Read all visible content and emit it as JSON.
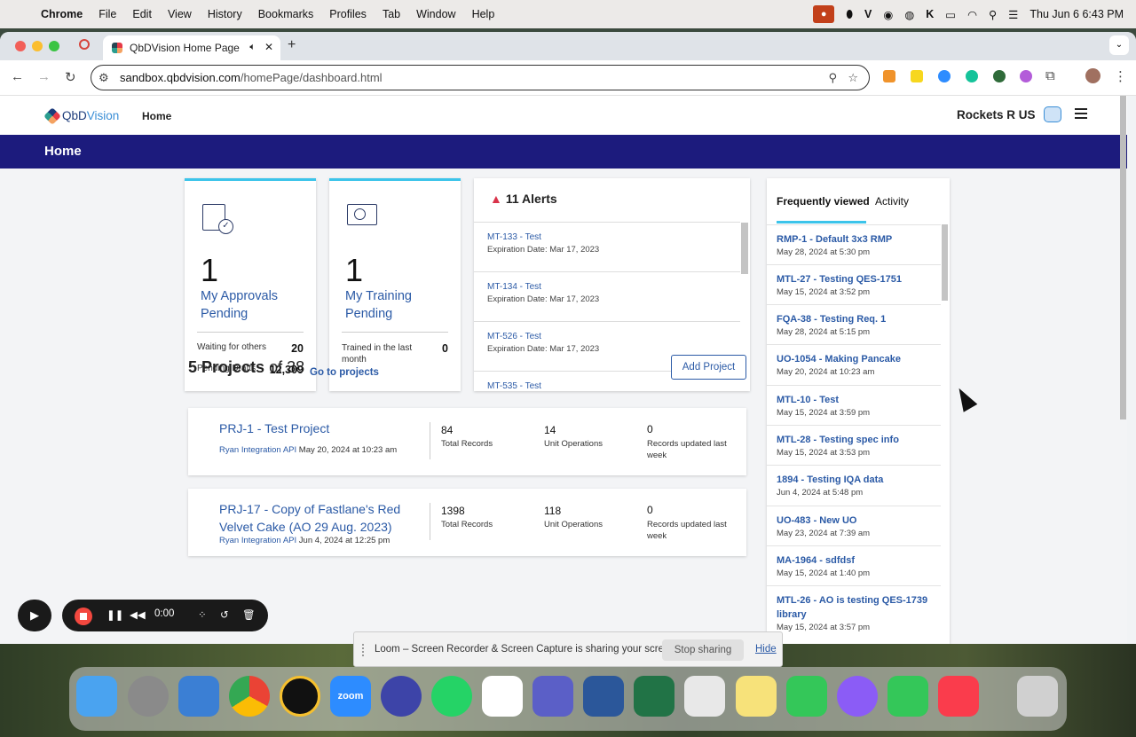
{
  "menubar": {
    "app": "Chrome",
    "items": [
      "File",
      "Edit",
      "View",
      "History",
      "Bookmarks",
      "Profiles",
      "Tab",
      "Window",
      "Help"
    ],
    "clock": "Thu Jun 6  6:43 PM"
  },
  "browser": {
    "tab_title": "QbDVision Home Page",
    "url_host": "sandbox.qbdvision.com",
    "url_path": "/homePage/dashboard.html"
  },
  "header": {
    "logo_text_1": "QbD",
    "logo_text_2": "Vision",
    "nav_home": "Home",
    "company": "Rockets R US"
  },
  "banner": {
    "title": "Home"
  },
  "approvals": {
    "count": "1",
    "title": "My Approvals Pending",
    "waiting_label": "Waiting for others",
    "waiting_value": "20",
    "drafts_label": "Pending Drafts",
    "drafts_value": "12,309"
  },
  "training": {
    "count": "1",
    "title": "My Training Pending",
    "trained_label": "Trained in the last month",
    "trained_value": "0"
  },
  "alerts": {
    "title": "11 Alerts",
    "items": [
      {
        "id": "MT-133 - Test",
        "date": "Expiration Date: Mar 17, 2023"
      },
      {
        "id": "MT-134 - Test",
        "date": "Expiration Date: Mar 17, 2023"
      },
      {
        "id": "MT-526 - Test",
        "date": "Expiration Date: Mar 17, 2023"
      },
      {
        "id": "MT-535 - Test",
        "date": ""
      }
    ]
  },
  "frequently_viewed": {
    "tab_active": "Frequently viewed",
    "tab_other": "Activity",
    "items": [
      {
        "label": "RMP-1 - Default 3x3 RMP",
        "date": "May 28, 2024 at 5:30 pm"
      },
      {
        "label": "MTL-27 - Testing QES-1751",
        "date": "May 15, 2024 at 3:52 pm"
      },
      {
        "label": "FQA-38 - Testing Req. 1",
        "date": "May 28, 2024 at 5:15 pm"
      },
      {
        "label": "UO-1054 - Making Pancake",
        "date": "May 20, 2024 at 10:23 am"
      },
      {
        "label": "MTL-10 - Test",
        "date": "May 15, 2024 at 3:59 pm"
      },
      {
        "label": "MTL-28 - Testing spec info",
        "date": "May 15, 2024 at 3:53 pm"
      },
      {
        "label": "1894 - Testing IQA data",
        "date": "Jun 4, 2024 at 5:48 pm"
      },
      {
        "label": "UO-483 - New UO",
        "date": "May 23, 2024 at 7:39 am"
      },
      {
        "label": "MA-1964 - sdfdsf",
        "date": "May 15, 2024 at 1:40 pm"
      },
      {
        "label": "MTL-26 - AO is testing QES-1739 library",
        "date": "May 15, 2024 at 3:57 pm"
      }
    ]
  },
  "projects": {
    "count_label": "5 Projects",
    "of_label": "of 38",
    "goto": "Go to projects",
    "add": "Add Project",
    "items": [
      {
        "title": "PRJ-1 - Test Project",
        "user": "Ryan Integration API",
        "date": " May 20, 2024 at 10:23 am",
        "records": "84",
        "records_label": "Total Records",
        "uo": "14",
        "uo_label": "Unit Operations",
        "updated": "0",
        "updated_label": "Records updated last week"
      },
      {
        "title": "PRJ-17 - Copy of Fastlane's Red Velvet Cake (AO 29 Aug. 2023)",
        "user": "Ryan Integration API",
        "date": " Jun 4, 2024 at 12:25 pm",
        "records": "1398",
        "records_label": "Total Records",
        "uo": "118",
        "uo_label": "Unit Operations",
        "updated": "0",
        "updated_label": "Records updated last week"
      }
    ]
  },
  "loom": {
    "timer": "0:00",
    "share_text": "Loom – Screen Recorder & Screen Capture is sharing your screen.",
    "stop_sharing": "Stop sharing",
    "hide": "Hide"
  },
  "dock": {
    "apps": [
      "finder-icon",
      "settings-icon",
      "preview-icon",
      "chrome-icon",
      "keeper-icon",
      "zoom-icon",
      "voice-icon",
      "whatsapp-icon",
      "slack-icon",
      "teams-icon",
      "word-icon",
      "excel-icon",
      "launchpad-icon",
      "notes-icon",
      "messages-icon",
      "messenger-icon",
      "facetime-icon",
      "music-icon",
      "trash-icon"
    ],
    "zoom_label": "zoom"
  }
}
